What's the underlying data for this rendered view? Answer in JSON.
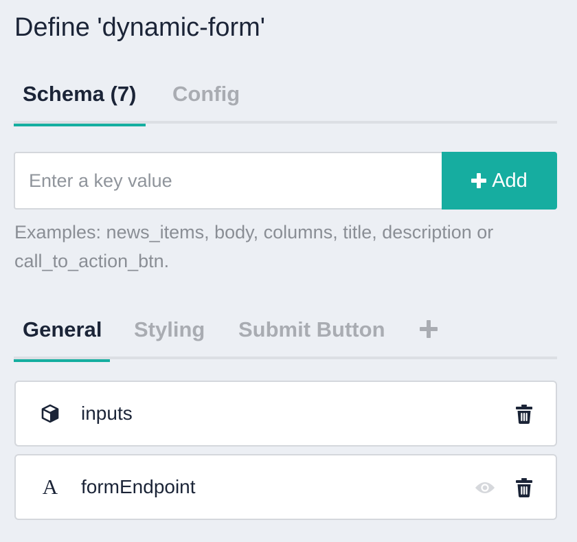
{
  "title": "Define 'dynamic-form'",
  "top_tabs": [
    {
      "label": "Schema (7)",
      "active": true
    },
    {
      "label": "Config",
      "active": false
    }
  ],
  "key_input": {
    "value": "",
    "placeholder": "Enter a key value"
  },
  "add_button": {
    "label": "Add",
    "icon": "plus-icon"
  },
  "hint": "Examples: news_items, body, columns, title, description or call_to_action_btn.",
  "sub_tabs": [
    {
      "label": "General",
      "active": true
    },
    {
      "label": "Styling",
      "active": false
    },
    {
      "label": "Submit Button",
      "active": false
    }
  ],
  "add_tab_icon": "plus-icon",
  "fields": [
    {
      "name": "inputs",
      "type_icon": "cube-icon",
      "actions": [
        "trash-icon"
      ]
    },
    {
      "name": "formEndpoint",
      "type_icon": "text-type-icon",
      "type_letter": "A",
      "actions": [
        "eye-icon",
        "trash-icon"
      ]
    }
  ],
  "colors": {
    "accent": "#16ada0",
    "background": "#eceff4",
    "text": "#1b2437",
    "muted": "#a9acb2"
  }
}
